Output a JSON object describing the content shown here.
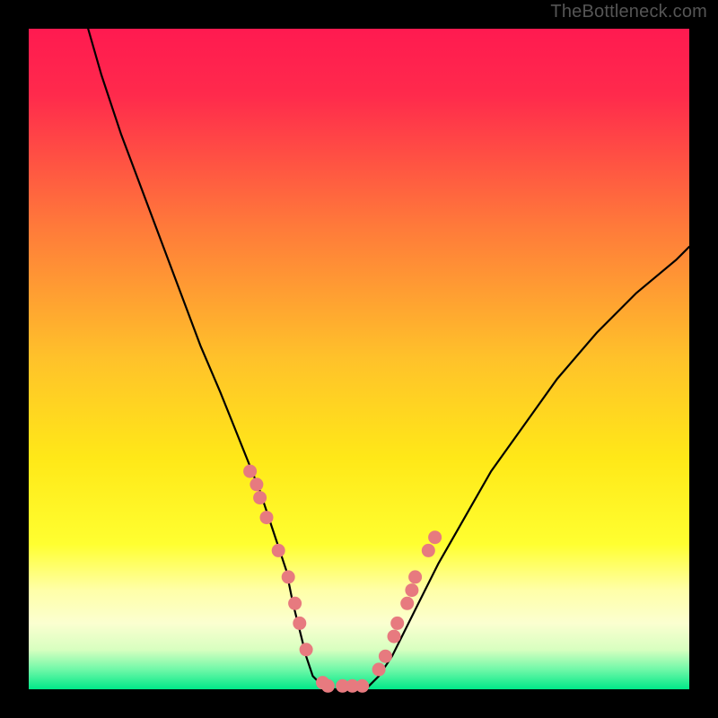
{
  "watermark": "TheBottleneck.com",
  "chart_data": {
    "type": "line",
    "title": "",
    "xlabel": "",
    "ylabel": "",
    "xlim": [
      0,
      100
    ],
    "ylim": [
      0,
      100
    ],
    "background_gradient_stops": [
      {
        "pos": 0.0,
        "color": "#ff1a50"
      },
      {
        "pos": 0.1,
        "color": "#ff2a4c"
      },
      {
        "pos": 0.3,
        "color": "#ff7a3a"
      },
      {
        "pos": 0.5,
        "color": "#ffc22a"
      },
      {
        "pos": 0.65,
        "color": "#ffe818"
      },
      {
        "pos": 0.78,
        "color": "#ffff30"
      },
      {
        "pos": 0.85,
        "color": "#ffffa8"
      },
      {
        "pos": 0.9,
        "color": "#fbffd0"
      },
      {
        "pos": 0.94,
        "color": "#d8ffc0"
      },
      {
        "pos": 0.97,
        "color": "#70f8a8"
      },
      {
        "pos": 1.0,
        "color": "#00e888"
      }
    ],
    "bottleneck_curve": {
      "x": [
        9,
        11,
        14,
        17,
        20,
        23,
        26,
        29,
        31,
        33,
        35,
        37,
        39,
        40,
        41,
        42,
        43,
        45,
        47,
        49,
        51,
        53,
        55,
        57,
        59,
        62,
        66,
        70,
        75,
        80,
        86,
        92,
        98,
        100
      ],
      "y": [
        100,
        93,
        84,
        76,
        68,
        60,
        52,
        45,
        40,
        35,
        30,
        24,
        18,
        13,
        9,
        5,
        2,
        0,
        0,
        0,
        0,
        2,
        5,
        9,
        13,
        19,
        26,
        33,
        40,
        47,
        54,
        60,
        65,
        67
      ]
    },
    "marker_points": {
      "x": [
        33.5,
        34.5,
        35,
        36,
        37.8,
        39.3,
        40.3,
        41.0,
        42.0,
        44.5,
        45.3,
        47.5,
        49.0,
        50.5,
        53.0,
        54.0,
        55.3,
        55.8,
        57.3,
        58.0,
        58.5,
        60.5,
        61.5
      ],
      "y": [
        33,
        31,
        29,
        26,
        21,
        17,
        13,
        10,
        6,
        1,
        0.5,
        0.5,
        0.5,
        0.5,
        3,
        5,
        8,
        10,
        13,
        15,
        17,
        21,
        23
      ],
      "color": "#e77a7f",
      "radius": 7.5
    }
  }
}
